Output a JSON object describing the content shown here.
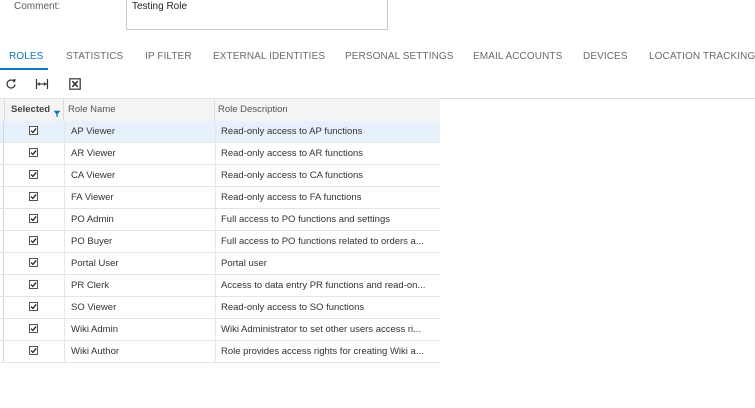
{
  "comment": {
    "label": "Comment:",
    "value": "Testing Role"
  },
  "tabs": [
    {
      "label": "ROLES",
      "active": true
    },
    {
      "label": "STATISTICS"
    },
    {
      "label": "IP FILTER"
    },
    {
      "label": "EXTERNAL IDENTITIES"
    },
    {
      "label": "PERSONAL SETTINGS"
    },
    {
      "label": "EMAIL ACCOUNTS"
    },
    {
      "label": "DEVICES"
    },
    {
      "label": "LOCATION TRACKING"
    }
  ],
  "toolbar": {
    "icons": [
      "refresh-icon",
      "fit-columns-icon",
      "export-excel-icon"
    ]
  },
  "grid": {
    "columns": {
      "selected": "Selected",
      "role_name": "Role Name",
      "role_description": "Role Description"
    },
    "rows": [
      {
        "selected": true,
        "role_name": "AP Viewer",
        "role_description": "Read-only access to AP functions"
      },
      {
        "selected": true,
        "role_name": "AR Viewer",
        "role_description": "Read-only access to AR functions"
      },
      {
        "selected": true,
        "role_name": "CA Viewer",
        "role_description": "Read-only access to CA functions"
      },
      {
        "selected": true,
        "role_name": "FA Viewer",
        "role_description": "Read-only access to FA functions"
      },
      {
        "selected": true,
        "role_name": "PO Admin",
        "role_description": "Full access to PO functions and settings"
      },
      {
        "selected": true,
        "role_name": "PO Buyer",
        "role_description": "Full access to PO functions related to orders a..."
      },
      {
        "selected": true,
        "role_name": "Portal User",
        "role_description": "Portal user"
      },
      {
        "selected": true,
        "role_name": "PR Clerk",
        "role_description": "Access to data entry PR functions and read-on..."
      },
      {
        "selected": true,
        "role_name": "SO Viewer",
        "role_description": "Read-only access to SO functions"
      },
      {
        "selected": true,
        "role_name": "Wiki Admin",
        "role_description": "Wiki Administrator to set other users access ri..."
      },
      {
        "selected": true,
        "role_name": "Wiki Author",
        "role_description": "Role provides access rights for creating Wiki a..."
      }
    ]
  },
  "colors": {
    "accent": "#0b76bd",
    "highlight_row": "#e6f1fb"
  }
}
